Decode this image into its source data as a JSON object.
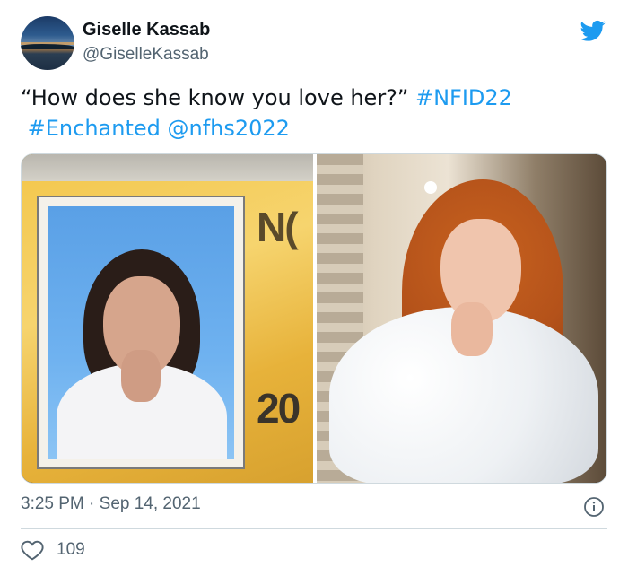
{
  "author": {
    "display_name": "Giselle Kassab",
    "handle": "@GiselleKassab",
    "avatar_icon": "avatar-lake-sunset"
  },
  "brand": {
    "icon": "twitter-bird-icon",
    "color": "#1d9bf0"
  },
  "tweet": {
    "text_plain": "“How does she know you love her?” ",
    "hashtag_1": "#NFID22",
    "hashtag_2": "#Enchanted",
    "mention": "@nfhs2022",
    "link_color": "#1d9bf0"
  },
  "media": {
    "left_overlay_top": "N(",
    "left_overlay_bottom": "20"
  },
  "meta": {
    "timestamp": "3:25 PM · Sep 14, 2021",
    "info_icon": "info-icon"
  },
  "actions": {
    "like_icon": "heart-icon",
    "like_count": "109"
  }
}
